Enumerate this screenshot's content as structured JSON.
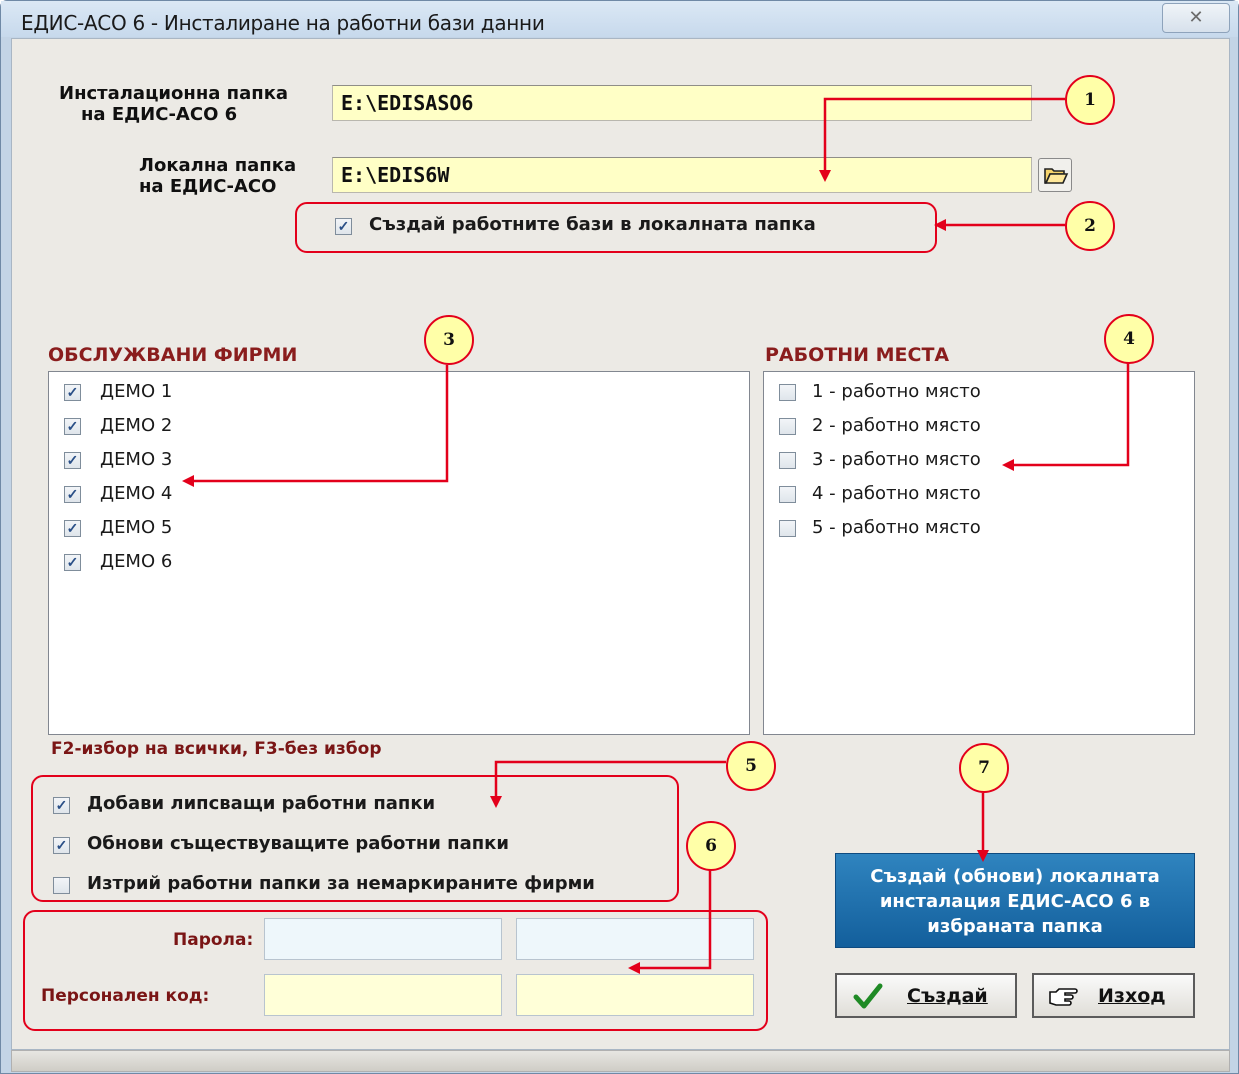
{
  "window": {
    "title": "ЕДИС-АСО 6 - Инсталиране на работни бази данни",
    "close_glyph": "✕"
  },
  "paths": {
    "install_label_line1": "Инсталационна папка",
    "install_label_line2": "на ЕДИС-АСО 6",
    "install_value": "E:\\EDISASO6",
    "local_label_line1": "Локална папка",
    "local_label_line2": "на ЕДИС-АСО",
    "local_value": "E:\\EDIS6W",
    "create_in_local": {
      "label": "Създай работните бази в локалната папка",
      "checked": true
    }
  },
  "firms": {
    "header": "ОБСЛУЖВАНИ ФИРМИ",
    "items": [
      {
        "label": "ДЕМО 1",
        "checked": true
      },
      {
        "label": "ДЕМО 2",
        "checked": true
      },
      {
        "label": "ДЕМО 3",
        "checked": true
      },
      {
        "label": "ДЕМО 4",
        "checked": true
      },
      {
        "label": "ДЕМО 5",
        "checked": true
      },
      {
        "label": "ДЕМО 6",
        "checked": true
      }
    ]
  },
  "workplaces": {
    "header": "РАБОТНИ МЕСТА",
    "items": [
      {
        "label": "1 - работно място",
        "checked": false
      },
      {
        "label": "2 - работно място",
        "checked": false
      },
      {
        "label": "3 - работно място",
        "checked": false
      },
      {
        "label": "4 - работно място",
        "checked": false
      },
      {
        "label": "5 - работно място",
        "checked": false
      }
    ]
  },
  "hint": "F2-избор на всички, F3-без избор",
  "options": [
    {
      "label": "Добави липсващи работни папки",
      "checked": true
    },
    {
      "label": "Обнови съществуващите работни папки",
      "checked": true
    },
    {
      "label": "Изтрий работни папки за немаркираните фирми",
      "checked": false
    }
  ],
  "auth": {
    "password_label": "Парола:",
    "personal_code_label": "Персонален код:"
  },
  "buttons": {
    "big_line1": "Създай (обнови) локалната",
    "big_line2": "инсталация ЕДИС-АСО 6 в",
    "big_line3": "избраната папка",
    "create": "Създай",
    "exit": "Изход"
  },
  "callouts": [
    "1",
    "2",
    "3",
    "4",
    "5",
    "6",
    "7"
  ],
  "colors": {
    "annotation_red": "#e3001b",
    "callout_fill": "#ffffa8",
    "section_red": "#8a1d1d",
    "field_yellow": "#ffffc6",
    "action_blue": "#1e6fae"
  }
}
